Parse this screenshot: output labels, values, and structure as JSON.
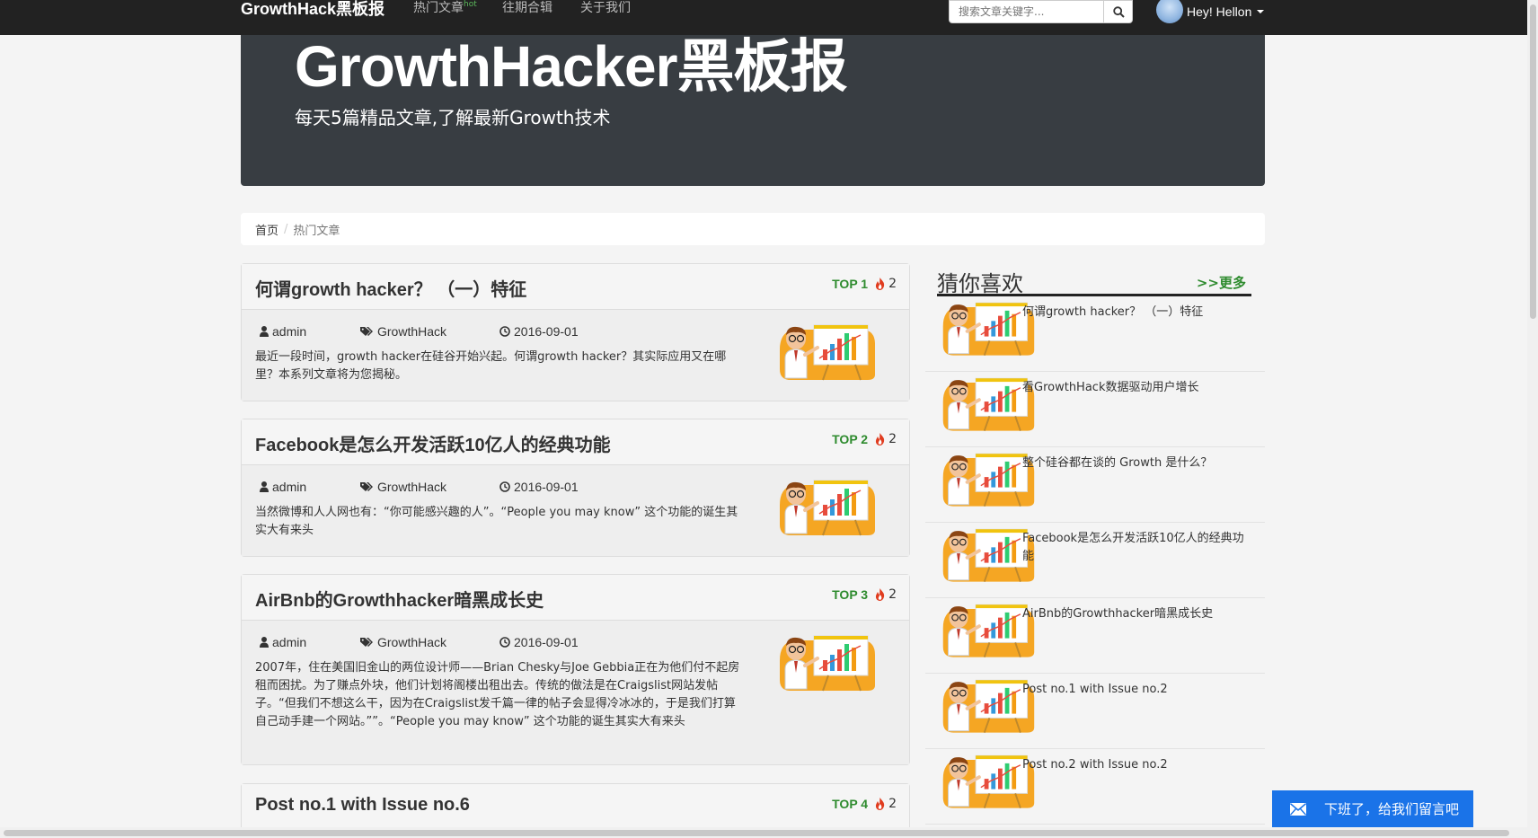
{
  "navbar": {
    "brand": "GrowthHack黑板报",
    "items": [
      {
        "label": "热门文章",
        "badge": "hot"
      },
      {
        "label": "往期合辑"
      },
      {
        "label": "关于我们"
      }
    ],
    "search_placeholder": "搜索文章关键字...",
    "user_greeting": "Hey!  Hellon"
  },
  "hero": {
    "title": "GrowthHacker黑板报",
    "subtitle": "每天5篇精品文章,了解最新Growth技术"
  },
  "breadcrumb": {
    "home": "首页",
    "separator": "/",
    "current": "热门文章"
  },
  "articles": [
    {
      "title": "何谓growth hacker？ （一）特征",
      "rank": "TOP 1",
      "count": "2",
      "author": "admin",
      "category": "GrowthHack",
      "date": "2016-09-01",
      "excerpt": "最近一段时间，growth hacker在硅谷开始兴起。何谓growth hacker？其实际应用又在哪里？本系列文章将为您揭秘。"
    },
    {
      "title": "Facebook是怎么开发活跃10亿人的经典功能",
      "rank": "TOP 2",
      "count": "2",
      "author": "admin",
      "category": "GrowthHack",
      "date": "2016-09-01",
      "excerpt": "当然微博和人人网也有：“你可能感兴趣的人”。“People you may know” 这个功能的诞生其实大有来头"
    },
    {
      "title": "AirBnb的Growthhacker暗黑成长史",
      "rank": "TOP 3",
      "count": "2",
      "author": "admin",
      "category": "GrowthHack",
      "date": "2016-09-01",
      "excerpt": "2007年，住在美国旧金山的两位设计师——Brian Chesky与Joe Gebbia正在为他们付不起房租而困扰。为了赚点外块，他们计划将阁楼出租出去。传统的做法是在Craigslist网站发帖子。“但我们不想这么干，因为在Craigslist发千篇一律的帖子会显得冷冰冰的，于是我们打算自己动手建一个网站。””。“People you may know” 这个功能的诞生其实大有来头"
    },
    {
      "title": "Post no.1 with Issue no.6",
      "rank": "TOP 4",
      "count": "2"
    }
  ],
  "sidebar": {
    "title": "猜你喜欢",
    "more": ">>更多",
    "items": [
      "何谓growth hacker？ （一）特征",
      "看GrowthHack数据驱动用户增长",
      "整个硅谷都在谈的 Growth 是什么？",
      "Facebook是怎么开发活跃10亿人的经典功能",
      "AirBnb的Growthhacker暗黑成长史",
      "Post no.1 with Issue no.2",
      "Post no.2 with Issue no.2"
    ]
  },
  "feedback": {
    "label": "下班了，给我们留言吧"
  },
  "colors": {
    "navbar": "#222222",
    "hero": "#383d42",
    "rank_green": "#2e8b2e",
    "fire_red": "#e03c1f",
    "feedback_blue": "#1a73e8"
  }
}
